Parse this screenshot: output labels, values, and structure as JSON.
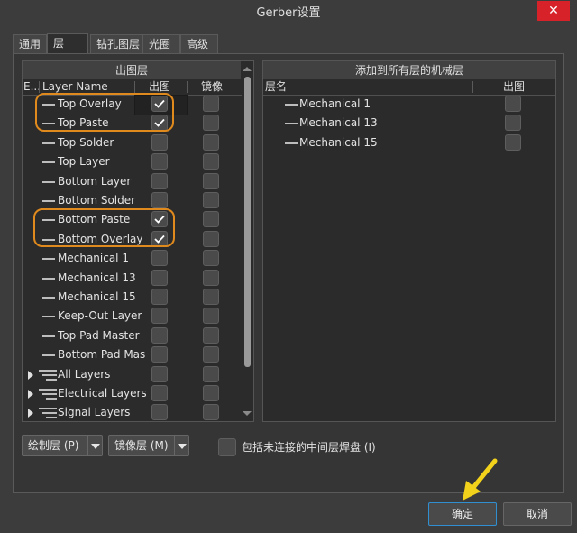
{
  "window": {
    "title": "Gerber设置",
    "close_glyph": "✕"
  },
  "tabs": [
    "通用",
    "层",
    "钻孔图层",
    "光圈",
    "高级"
  ],
  "left_panel": {
    "header": "出图层",
    "col_e": "E...",
    "col_layer": "Layer Name",
    "col_plot": "出图",
    "col_mirror": "镜像",
    "rows": [
      {
        "name": "Top Overlay",
        "plot": true,
        "mirror": false
      },
      {
        "name": "Top Paste",
        "plot": true,
        "mirror": false
      },
      {
        "name": "Top Solder",
        "plot": false,
        "mirror": false
      },
      {
        "name": "Top Layer",
        "plot": false,
        "mirror": false
      },
      {
        "name": "Bottom Layer",
        "plot": false,
        "mirror": false
      },
      {
        "name": "Bottom Solder",
        "plot": false,
        "mirror": false
      },
      {
        "name": "Bottom Paste",
        "plot": true,
        "mirror": false
      },
      {
        "name": "Bottom Overlay",
        "plot": true,
        "mirror": false
      },
      {
        "name": "Mechanical 1",
        "plot": false,
        "mirror": false
      },
      {
        "name": "Mechanical 13",
        "plot": false,
        "mirror": false
      },
      {
        "name": "Mechanical 15",
        "plot": false,
        "mirror": false
      },
      {
        "name": "Keep-Out Layer",
        "plot": false,
        "mirror": false
      },
      {
        "name": "Top Pad Master",
        "plot": false,
        "mirror": false
      },
      {
        "name": "Bottom Pad Mas",
        "plot": false,
        "mirror": false
      }
    ],
    "groups": [
      {
        "name": "All Layers"
      },
      {
        "name": "Electrical Layers"
      },
      {
        "name": "Signal Layers"
      }
    ]
  },
  "right_panel": {
    "header": "添加到所有层的机械层",
    "col_layer": "层名",
    "col_plot": "出图",
    "rows": [
      {
        "name": "Mechanical 1",
        "plot": false
      },
      {
        "name": "Mechanical 13",
        "plot": false
      },
      {
        "name": "Mechanical 15",
        "plot": false
      }
    ]
  },
  "bottom": {
    "plot_layers_btn": "绘制层 (P)",
    "mirror_layers_btn": "镜像层 (M)",
    "include_unconnected": "包括未连接的中间层焊盘 (I)"
  },
  "footer": {
    "ok": "确定",
    "cancel": "取消"
  },
  "colors": {
    "highlight_oval": "#e08a1e",
    "arrow": "#f2d21b",
    "close": "#d8222a"
  }
}
